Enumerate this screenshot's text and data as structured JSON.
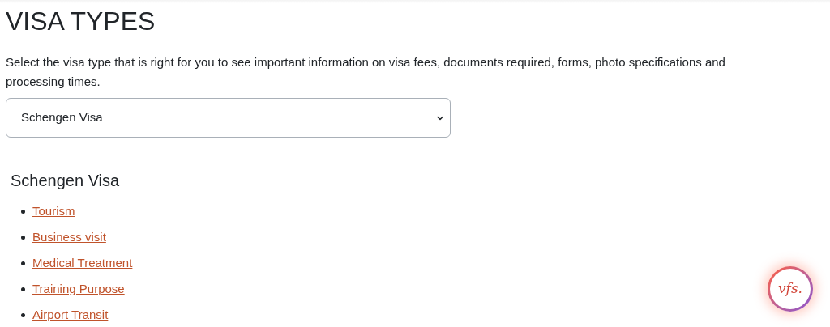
{
  "title": "VISA TYPES",
  "intro": "Select the visa type that is right for you to see important information on visa fees, documents required, forms, photo specifications and processing times.",
  "visa_select": {
    "value": "Schengen Visa"
  },
  "section": {
    "heading": "Schengen Visa",
    "links": [
      "Tourism",
      "Business visit",
      "Medical Treatment",
      "Training Purpose",
      "Airport Transit"
    ]
  },
  "chat_badge": {
    "text": "vfs."
  }
}
